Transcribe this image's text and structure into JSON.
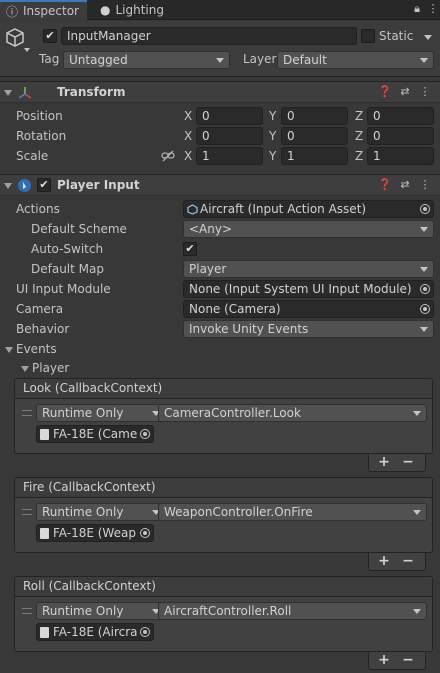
{
  "tabs": [
    {
      "label": "Inspector",
      "icon": "inspector-icon"
    },
    {
      "label": "Lighting",
      "icon": "lightbulb-icon"
    }
  ],
  "object": {
    "name": "InputManager",
    "active": true,
    "static_label": "Static",
    "static": false,
    "tag_label": "Tag",
    "tag": "Untagged",
    "layer_label": "Layer",
    "layer": "Default"
  },
  "transform": {
    "title": "Transform",
    "rows": [
      {
        "label": "Position",
        "x": "0",
        "y": "0",
        "z": "0"
      },
      {
        "label": "Rotation",
        "x": "0",
        "y": "0",
        "z": "0"
      },
      {
        "label": "Scale",
        "x": "1",
        "y": "1",
        "z": "1"
      }
    ],
    "axes": {
      "x": "X",
      "y": "Y",
      "z": "Z"
    }
  },
  "player_input": {
    "title": "Player Input",
    "enabled": true,
    "actions_label": "Actions",
    "actions_value": "Aircraft (Input Action Asset)",
    "default_scheme_label": "Default Scheme",
    "default_scheme_value": "<Any>",
    "auto_switch_label": "Auto-Switch",
    "auto_switch": true,
    "default_map_label": "Default Map",
    "default_map_value": "Player",
    "ui_module_label": "UI Input Module",
    "ui_module_value": "None (Input System UI Input Module)",
    "camera_label": "Camera",
    "camera_value": "None (Camera)",
    "behavior_label": "Behavior",
    "behavior_value": "Invoke Unity Events",
    "events_label": "Events",
    "player_label": "Player"
  },
  "events": [
    {
      "title": "Look (CallbackContext)",
      "mode": "Runtime Only",
      "function": "CameraController.Look",
      "object": "FA-18E (Came"
    },
    {
      "title": "Fire (CallbackContext)",
      "mode": "Runtime Only",
      "function": "WeaponController.OnFire",
      "object": "FA-18E (Weap"
    },
    {
      "title": "Roll (CallbackContext)",
      "mode": "Runtime Only",
      "function": "AircraftController.Roll",
      "object": "FA-18E (Aircra"
    }
  ],
  "plus_label": "+",
  "minus_label": "−",
  "colors": {
    "accent": "#3a79bb",
    "background": "#383838",
    "field": "#2a2a2a"
  }
}
